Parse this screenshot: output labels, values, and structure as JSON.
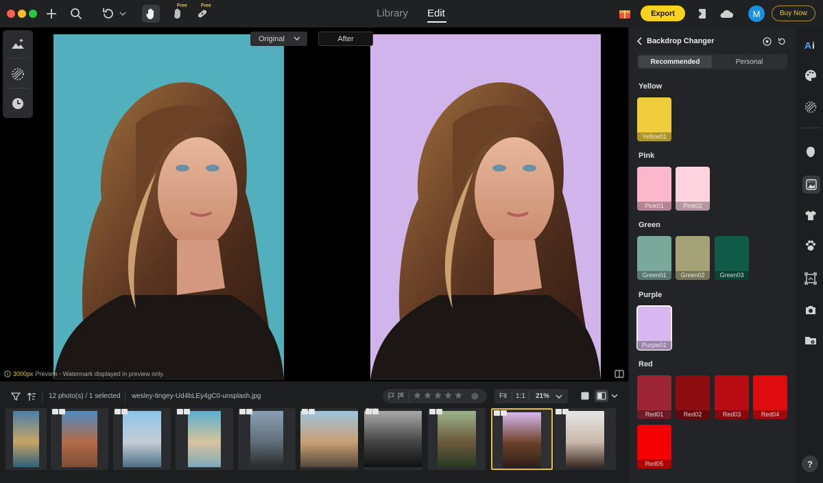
{
  "window": {
    "traffic_lights": [
      "#fe5f57",
      "#febc2e",
      "#28c840"
    ]
  },
  "toolbar": {
    "free_badge_1": "Free",
    "free_badge_2": "Free"
  },
  "nav": {
    "tabs": [
      "Library",
      "Edit"
    ],
    "active_tab": "Edit"
  },
  "actions": {
    "export_label": "Export",
    "avatar_initial": "M",
    "buy_now_label": "Buy Now"
  },
  "compare": {
    "original_label": "Original",
    "after_label": "After"
  },
  "preview_note": {
    "px_value": "3000px",
    "text": "Preview - Watermark displayed in preview only."
  },
  "panel": {
    "title": "Backdrop Changer",
    "tabs": [
      "Recommended",
      "Personal"
    ],
    "active_tab": "Recommended",
    "groups": [
      {
        "name": "Yellow",
        "swatches": [
          {
            "label": "Yellow01",
            "color": "#f0cd3c"
          }
        ]
      },
      {
        "name": "Pink",
        "swatches": [
          {
            "label": "Pink01",
            "color": "#fbb8cc"
          },
          {
            "label": "Pink02",
            "color": "#fcd3de"
          }
        ]
      },
      {
        "name": "Green",
        "swatches": [
          {
            "label": "Green01",
            "color": "#7aa89a"
          },
          {
            "label": "Green02",
            "color": "#a5a277"
          },
          {
            "label": "Green03",
            "color": "#0f5b48"
          }
        ]
      },
      {
        "name": "Purple",
        "swatches": [
          {
            "label": "Purple01",
            "color": "#d8b8ee",
            "selected": true
          }
        ]
      },
      {
        "name": "Red",
        "swatches": [
          {
            "label": "Red01",
            "color": "#9c2434"
          },
          {
            "label": "Red02",
            "color": "#8c0c10"
          },
          {
            "label": "Red03",
            "color": "#b90d14"
          },
          {
            "label": "Red04",
            "color": "#de0c0e"
          },
          {
            "label": "Red05",
            "color": "#f40000"
          }
        ]
      }
    ]
  },
  "filmstrip": {
    "count_text": "12 photo(s) / 1 selected",
    "filename": "wesley-tingey-Ud4bLEy4gC0-unsplash.jpg",
    "zoom": {
      "fit_label": "Fit",
      "one_to_one_label": "1:1",
      "value": "21%"
    },
    "rating_stars": 5,
    "raw_badge": "RAW",
    "selected_index": 8,
    "thumbs": [
      {
        "colors": [
          "#4a7fa8",
          "#c5a465",
          "#2e5f7a"
        ]
      },
      {
        "colors": [
          "#4e8bc0",
          "#b36b4a",
          "#7c4e34"
        ]
      },
      {
        "colors": [
          "#8cc4ea",
          "#c4cdd6",
          "#4d6f86"
        ]
      },
      {
        "colors": [
          "#5aaed0",
          "#d6c39e",
          "#7ea8ba"
        ]
      },
      {
        "colors": [
          "#8ca0b4",
          "#5f6d7a",
          "#2c2a28"
        ]
      },
      {
        "colors": [
          "#9bc4de",
          "#c9a074",
          "#55473a"
        ]
      },
      {
        "colors": [
          "#aaaaaa",
          "#444444",
          "#111111"
        ]
      },
      {
        "colors": [
          "#9db48c",
          "#6b5a3c",
          "#2a3a24"
        ]
      },
      {
        "colors": [
          "#d8b8ee",
          "#6b4028",
          "#2a1e1a"
        ]
      },
      {
        "colors": [
          "#e6e6e6",
          "#c9b8aa",
          "#3a2a24"
        ]
      }
    ]
  },
  "help_label": "?"
}
